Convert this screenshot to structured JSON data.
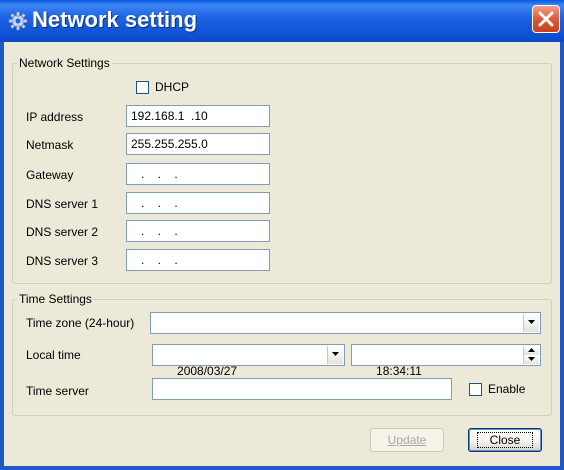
{
  "window": {
    "title": "Network setting",
    "title_icon": "gear-icon",
    "close_icon": "close-icon"
  },
  "network": {
    "legend": "Network Settings",
    "dhcp_label": "DHCP",
    "dhcp_checked": false,
    "ip_label": "IP address",
    "ip_value": "192.168.1  .10",
    "netmask_label": "Netmask",
    "netmask_value": "255.255.255.0",
    "gateway_label": "Gateway",
    "gateway_value": "   .    .    .",
    "dns1_label": "DNS server 1",
    "dns1_value": "   .    .    .",
    "dns2_label": "DNS server 2",
    "dns2_value": "   .    .    .",
    "dns3_label": "DNS server 3",
    "dns3_value": "   .    .    ."
  },
  "time": {
    "legend": "Time Settings",
    "timezone_label": "Time zone (24-hour)",
    "timezone_value": "",
    "localtime_label": "Local time",
    "date_value": "2008/03/27",
    "time_value": "18:34:11",
    "timeserver_label": "Time server",
    "timeserver_value": "",
    "enable_label": "Enable",
    "enable_checked": false
  },
  "buttons": {
    "update_label": "Update",
    "close_label": "Close"
  },
  "colors": {
    "title_bar": "#0c53d9",
    "client_bg": "#ece9d8",
    "close_button": "#dd5a36"
  }
}
